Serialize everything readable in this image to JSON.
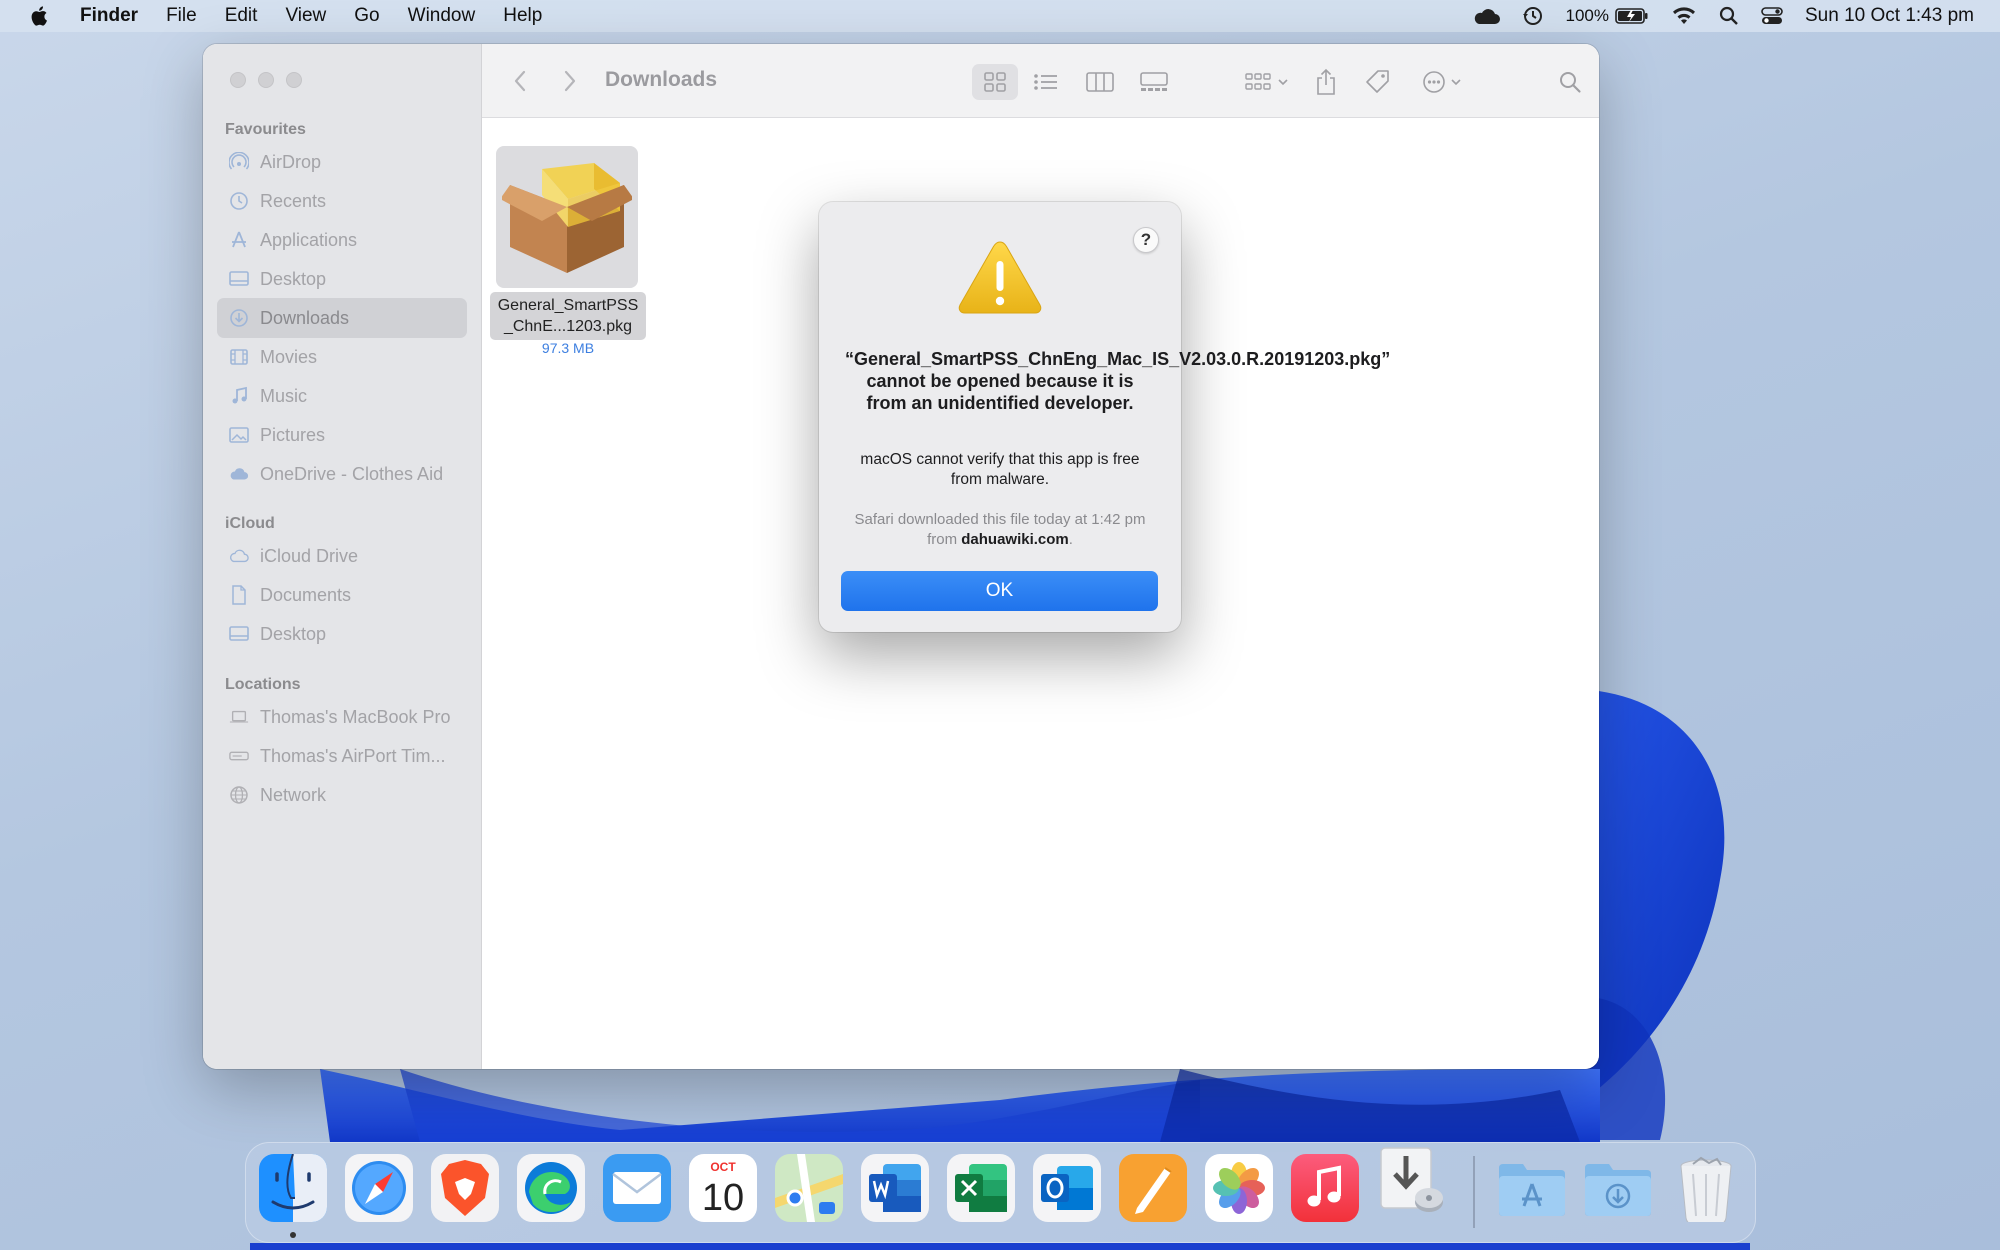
{
  "menubar": {
    "app_name": "Finder",
    "menus": [
      "File",
      "Edit",
      "View",
      "Go",
      "Window",
      "Help"
    ],
    "battery": "100%",
    "datetime": "Sun 10 Oct  1:43 pm"
  },
  "finder": {
    "title": "Downloads",
    "sidebar": {
      "favourites_label": "Favourites",
      "favourites": [
        "AirDrop",
        "Recents",
        "Applications",
        "Desktop",
        "Downloads",
        "Movies",
        "Music",
        "Pictures",
        "OneDrive - Clothes Aid"
      ],
      "icloud_label": "iCloud",
      "icloud": [
        "iCloud Drive",
        "Documents",
        "Desktop"
      ],
      "locations_label": "Locations",
      "locations": [
        "Thomas's MacBook Pro",
        "Thomas's AirPort Tim...",
        "Network"
      ]
    },
    "file": {
      "name": "General_SmartPSS_ChnE...1203.pkg",
      "size": "97.3 MB"
    }
  },
  "alert": {
    "headline": "“General_SmartPSS_ChnEng_Mac_IS_V2.03.0.R.20191203.pkg” cannot be opened because it is from an unidentified developer.",
    "body": "macOS cannot verify that this app is free from malware.",
    "source_prefix": "Safari downloaded this file today at 1:42 pm from",
    "source_domain": "dahuawiki.com",
    "source_suffix": ".",
    "help_label": "?",
    "ok_label": "OK"
  },
  "dock": {
    "calendar_month": "OCT",
    "calendar_day": "10",
    "apps": [
      "finder-icon",
      "safari-icon",
      "brave-icon",
      "edge-icon",
      "mail-icon",
      "calendar-icon",
      "maps-icon",
      "word-icon",
      "excel-icon",
      "outlook-icon",
      "pages-icon",
      "photos-icon",
      "music-icon",
      "installer-icon",
      "applications-folder-icon",
      "downloads-folder-icon",
      "trash-icon"
    ]
  }
}
